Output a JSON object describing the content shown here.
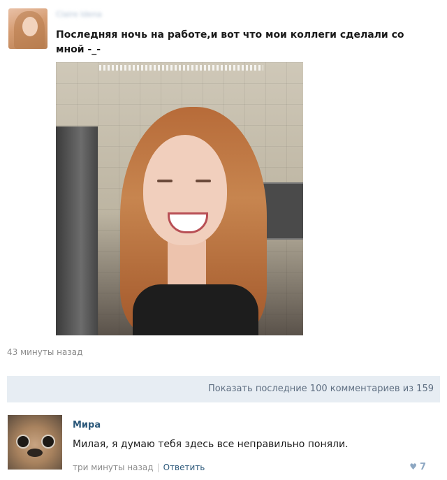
{
  "post": {
    "author_name": "Claire Idena",
    "text": "Последняя ночь на работе,и вот что мои коллеги сделали со мной -_-",
    "timestamp": "43 минуты назад"
  },
  "comments_bar": {
    "label": "Показать последние 100 комментариев из 159"
  },
  "comment": {
    "author": "Мира",
    "text": "Милая, я думаю тебя здесь все неправильно поняли.",
    "time": "три минуты назад",
    "reply_label": "Ответить",
    "likes": "7"
  },
  "icons": {
    "like": "heart-icon"
  },
  "colors": {
    "link": "#2b587a",
    "bar_background": "#e7edf3",
    "meta_text": "#8b8b8b"
  }
}
